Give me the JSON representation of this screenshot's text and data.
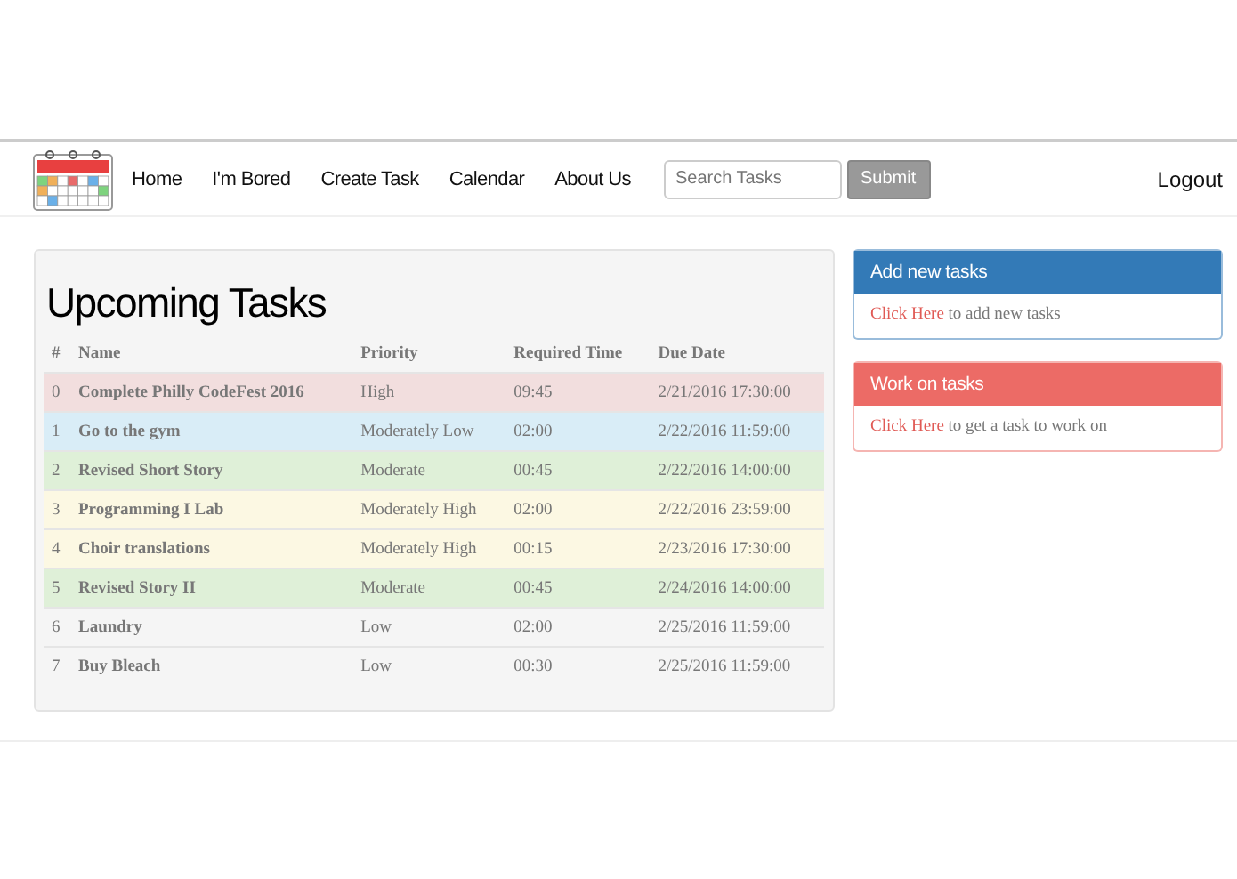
{
  "nav": {
    "links": [
      "Home",
      "I'm Bored",
      "Create Task",
      "Calendar",
      "About Us"
    ],
    "search": {
      "placeholder": "Search Tasks"
    },
    "submit": "Submit",
    "logout": "Logout"
  },
  "tasks": {
    "title": "Upcoming Tasks",
    "columns": [
      "#",
      "Name",
      "Priority",
      "Required Time",
      "Due Date"
    ],
    "rows": [
      {
        "index": "0",
        "name": "Complete Philly CodeFest 2016",
        "priority": "High",
        "time": "09:45",
        "due": "2/21/2016 17:30:00",
        "color": "#f2dede"
      },
      {
        "index": "1",
        "name": "Go to the gym",
        "priority": "Moderately Low",
        "time": "02:00",
        "due": "2/22/2016 11:59:00",
        "color": "#d9edf7"
      },
      {
        "index": "2",
        "name": "Revised Short Story",
        "priority": "Moderate",
        "time": "00:45",
        "due": "2/22/2016 14:00:00",
        "color": "#dff0d8"
      },
      {
        "index": "3",
        "name": "Programming I Lab",
        "priority": "Moderately High",
        "time": "02:00",
        "due": "2/22/2016 23:59:00",
        "color": "#fcf8e3"
      },
      {
        "index": "4",
        "name": "Choir translations",
        "priority": "Moderately High",
        "time": "00:15",
        "due": "2/23/2016 17:30:00",
        "color": "#fcf8e3"
      },
      {
        "index": "5",
        "name": "Revised Story II",
        "priority": "Moderate",
        "time": "00:45",
        "due": "2/24/2016 14:00:00",
        "color": "#dff0d8"
      },
      {
        "index": "6",
        "name": "Laundry",
        "priority": "Low",
        "time": "02:00",
        "due": "2/25/2016 11:59:00",
        "color": "#f5f5f5"
      },
      {
        "index": "7",
        "name": "Buy Bleach",
        "priority": "Low",
        "time": "00:30",
        "due": "2/25/2016 11:59:00",
        "color": "#f5f5f5"
      }
    ]
  },
  "panels": [
    {
      "title": "Add new tasks",
      "link": "Click Here",
      "text": " to add new tasks",
      "color": "#337ab7"
    },
    {
      "title": "Work on tasks",
      "link": "Click Here",
      "text": " to get a task to work on",
      "color": "#ec6b66"
    }
  ]
}
